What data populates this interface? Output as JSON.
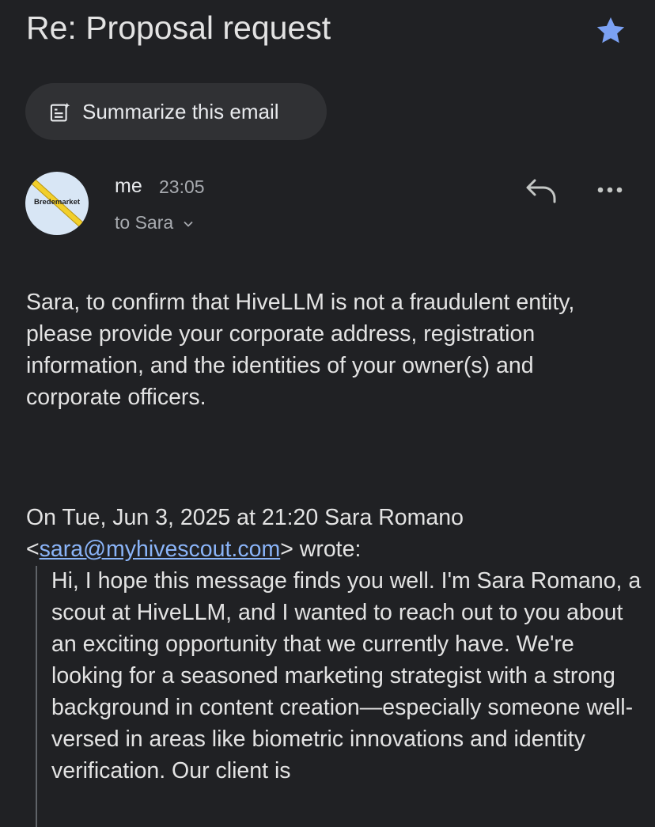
{
  "email": {
    "subject": "Re: Proposal request",
    "starred": true,
    "summarize_label": "Summarize this email",
    "avatar_brand": "Bredemarket",
    "sender": "me",
    "time": "23:05",
    "recipient": "to Sara",
    "body": "Sara, to confirm that HiveLLM is not a fraudulent entity, please provide your corporate address, registration information, and the identities of your owner(s) and corporate officers.",
    "quote_header_prefix": "On Tue, Jun 3, 2025 at 21:20 Sara Romano <",
    "quote_email": "sara@myhivescout.com",
    "quote_header_suffix": "> wrote:",
    "quoted_text": "Hi, I hope this message finds you well. I'm Sara Romano, a scout at HiveLLM, and I wanted to reach out to you about an exciting opportunity that we currently have. We're looking for a seasoned marketing strategist with a strong background in content creation—especially someone well-versed in areas like biometric innovations and identity verification. Our client is"
  },
  "icons": {
    "star": "star-icon",
    "summarize": "summarize-icon",
    "reply": "reply-icon",
    "more": "more-options-icon",
    "chevron": "chevron-down-icon"
  },
  "colors": {
    "background": "#202124",
    "star": "#7ba1f3",
    "link": "#8ab4f8",
    "chip": "#303134"
  }
}
